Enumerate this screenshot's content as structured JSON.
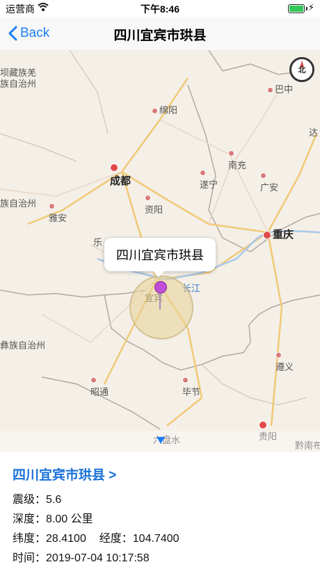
{
  "status": {
    "carrier": "运营商",
    "time": "下午8:46"
  },
  "nav": {
    "back_label": "Back",
    "title": "四川宜宾市珙县"
  },
  "map": {
    "compass_label": "北",
    "callout_text": "四川宜宾市珙县",
    "cities": [
      {
        "name": "坝藏族羌",
        "kind": "minor"
      },
      {
        "name": "族自治州",
        "kind": "minor"
      },
      {
        "name": "巴中",
        "kind": "minor"
      },
      {
        "name": "绵阳",
        "kind": "minor"
      },
      {
        "name": "达",
        "kind": "minor"
      },
      {
        "name": "成都",
        "kind": "major"
      },
      {
        "name": "南充",
        "kind": "minor"
      },
      {
        "name": "遂宁",
        "kind": "minor"
      },
      {
        "name": "广安",
        "kind": "minor"
      },
      {
        "name": "族自治州",
        "kind": "minor"
      },
      {
        "name": "资阳",
        "kind": "minor"
      },
      {
        "name": "雅安",
        "kind": "minor"
      },
      {
        "name": "重庆",
        "kind": "major"
      },
      {
        "name": "乐",
        "kind": "minor"
      },
      {
        "name": "长江",
        "kind": "blue"
      },
      {
        "name": "宜宾",
        "kind": "minor"
      },
      {
        "name": "彝族自治州",
        "kind": "minor"
      },
      {
        "name": "遵义",
        "kind": "minor"
      },
      {
        "name": "昭通",
        "kind": "minor"
      },
      {
        "name": "毕节",
        "kind": "minor"
      },
      {
        "name": "贵阳",
        "kind": "minor"
      },
      {
        "name": "六盘水",
        "kind": "minor"
      },
      {
        "name": "黔南布",
        "kind": "minor"
      }
    ]
  },
  "info": {
    "title": "四川宜宾市珙县 >",
    "magnitude_label": "震级：",
    "magnitude": "5.6",
    "depth_label": "深度：",
    "depth": "8.00 公里",
    "lat_label": "纬度：",
    "lat": "28.4100",
    "lon_label": "经度：",
    "lon": "104.7400",
    "time_label": "时间：",
    "time": "2019-07-04 10:17:58"
  },
  "colors": {
    "accent": "#1a7ff5",
    "link": "#1a72d8",
    "pin": "#c050d8"
  }
}
